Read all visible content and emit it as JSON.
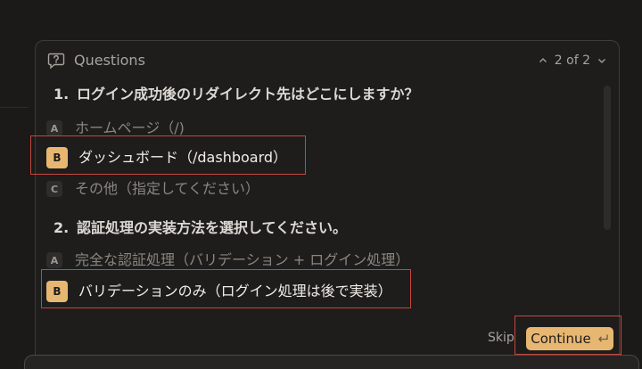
{
  "panel": {
    "title": "Questions",
    "pager": "2 of 2",
    "icon": "question-bubble-icon"
  },
  "questions": [
    {
      "number": "1.",
      "text": "ログイン成功後のリダイレクト先はどこにしますか？",
      "options": [
        {
          "key": "A",
          "label": "ホームページ（/)",
          "selected": false
        },
        {
          "key": "B",
          "label": "ダッシュボード（/dashboard）",
          "selected": true
        },
        {
          "key": "C",
          "label": "その他（指定してください）",
          "selected": false
        }
      ]
    },
    {
      "number": "2.",
      "text": "認証処理の実装方法を選択してください。",
      "options": [
        {
          "key": "A",
          "label": "完全な認証処理（バリデーション + ログイン処理）",
          "selected": false
        },
        {
          "key": "B",
          "label": "バリデーションのみ（ログイン処理は後で実装）",
          "selected": true
        }
      ]
    }
  ],
  "actions": {
    "skip_label": "Skip",
    "continue_label": "Continue",
    "continue_icon": "enter-key-icon"
  },
  "colors": {
    "accent": "#e7b772",
    "highlight": "#c4473f",
    "background": "#1b1a19"
  }
}
